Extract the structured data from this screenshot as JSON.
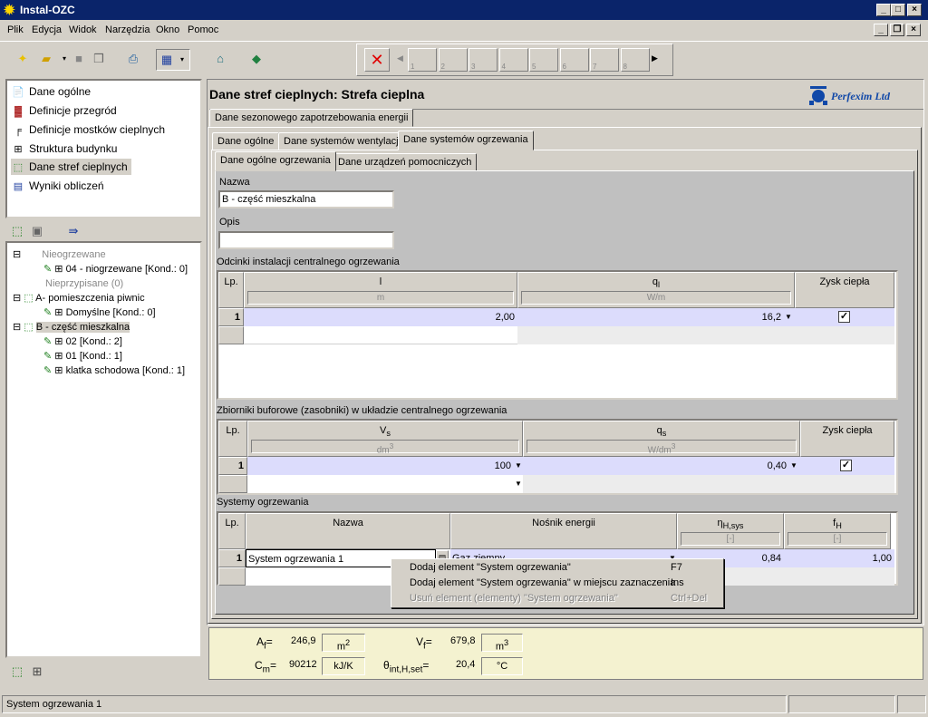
{
  "window": {
    "title": "Instal-OZC"
  },
  "menu": [
    "Plik",
    "Edycja",
    "Widok",
    "Narzędzia",
    "Okno",
    "Pomoc"
  ],
  "stepper": {
    "steps": [
      "1",
      "2",
      "3",
      "4",
      "5",
      "6",
      "7",
      "8"
    ]
  },
  "nav": {
    "items": [
      "Dane ogólne",
      "Definicje przegród",
      "Definicje mostków cieplnych",
      "Struktura budynku",
      "Dane stref cieplnych",
      "Wyniki obliczeń"
    ]
  },
  "tree": {
    "g1": "Nieogrzewane",
    "g1a": "04 - niogrzewane [Kond.: 0]",
    "g2": "Nieprzypisane (0)",
    "g3": "A- pomieszczenia piwnic",
    "g3a": "Domyślne [Kond.: 0]",
    "g4": "B - część mieszkalna",
    "g4a": "02 [Kond.: 2]",
    "g4b": "01 [Kond.: 1]",
    "g4c": "klatka schodowa [Kond.: 1]"
  },
  "panel": {
    "title": "Dane stref cieplnych: Strefa cieplna",
    "logo": "Perfexim Ltd"
  },
  "tabs": {
    "l1": "Dane sezonowego zapotrzebowania energii",
    "l2": [
      "Dane ogólne",
      "Dane systemów wentylacji",
      "Dane systemów ogrzewania"
    ],
    "l3": [
      "Dane ogólne ogrzewania",
      "Dane urządzeń pomocniczych"
    ]
  },
  "form": {
    "name_label": "Nazwa",
    "name_value": "B - część mieszkalna",
    "desc_label": "Opis",
    "desc_value": ""
  },
  "pipes": {
    "title": "Odcinki instalacji centralnego ogrzewania",
    "headers": {
      "lp": "Lp.",
      "l": "l",
      "l_unit": "m",
      "q": "q",
      "q_sub": "l",
      "q_unit": "W/m",
      "gain": "Zysk ciepła"
    },
    "rows": [
      {
        "lp": "1",
        "l": "2,00",
        "q": "16,2",
        "gain": true
      }
    ]
  },
  "buffers": {
    "title": "Zbiorniki buforowe (zasobniki) w układzie centralnego ogrzewania",
    "headers": {
      "lp": "Lp.",
      "v": "V",
      "v_sub": "s",
      "v_unit": "dm",
      "v_sup": "3",
      "q": "q",
      "q_sub": "s",
      "q_unit": "W/dm",
      "q_sup": "3",
      "gain": "Zysk ciepła"
    },
    "rows": [
      {
        "lp": "1",
        "v": "100",
        "q": "0,40",
        "gain": true
      }
    ]
  },
  "systems": {
    "title": "Systemy ogrzewania",
    "headers": {
      "lp": "Lp.",
      "name": "Nazwa",
      "carrier": "Nośnik energii",
      "eta": "η",
      "eta_sub": "H,sys",
      "eta_unit": "[-]",
      "f": "f",
      "f_sub": "H",
      "f_unit": "[-]"
    },
    "rows": [
      {
        "lp": "1",
        "name": "System ogrzewania 1",
        "carrier": "Gaz ziemny",
        "eta": "0,84",
        "f": "1,00"
      }
    ]
  },
  "context_menu": [
    {
      "label": "Dodaj element \"System ogrzewania\"",
      "key": "F7",
      "enabled": true
    },
    {
      "label": "Dodaj element \"System ogrzewania\" w miejscu zaznaczenia",
      "key": "Ins",
      "enabled": true
    },
    {
      "label": "Usuń element (elementy) \"System ogrzewania\"",
      "key": "Ctrl+Del",
      "enabled": false
    }
  ],
  "summary": {
    "af_label": "A",
    "af_sub": "f",
    "af_val": "246,9",
    "af_unit": "m",
    "af_sup": "2",
    "vf_label": "V",
    "vf_sub": "f",
    "vf_val": "679,8",
    "vf_unit": "m",
    "vf_sup": "3",
    "cm_label": "C",
    "cm_sub": "m",
    "cm_val": "90212",
    "cm_unit": "kJ/K",
    "th_label": "θ",
    "th_sub": "int,H,set",
    "th_val": "20,4",
    "th_unit": "°C"
  },
  "status": {
    "text": "System ogrzewania 1"
  },
  "colors": {
    "title_bg": "#0a246a",
    "face": "#d4d0c8",
    "summary_bg": "#f4f2d0",
    "sel_row": "#dcdcfc"
  }
}
